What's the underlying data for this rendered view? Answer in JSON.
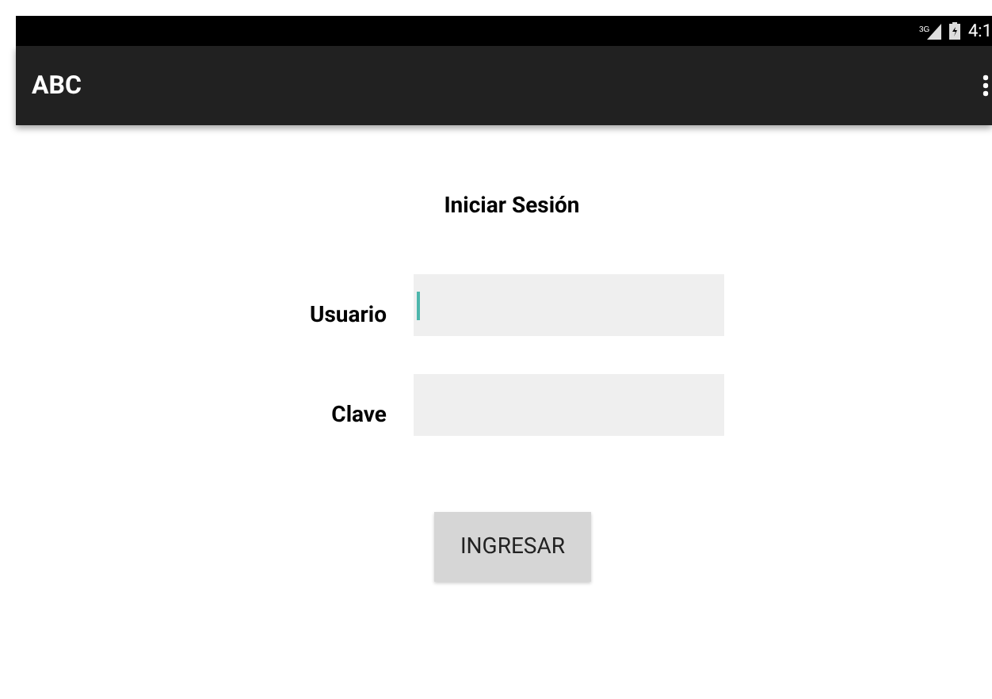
{
  "status_bar": {
    "network": "3G",
    "time": "4:1"
  },
  "app_bar": {
    "title": "ABC"
  },
  "form": {
    "title": "Iniciar Sesión",
    "fields": [
      {
        "label": "Usuario",
        "focused": true
      },
      {
        "label": "Clave",
        "focused": false
      }
    ],
    "button": "INGRESAR"
  }
}
